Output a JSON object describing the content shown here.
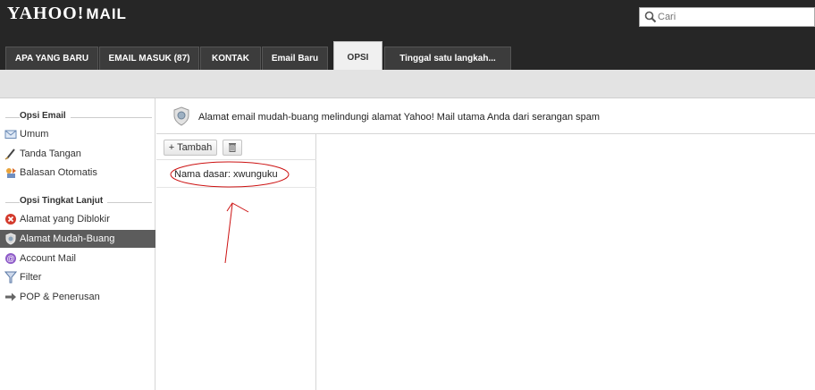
{
  "app": {
    "logo_text": "YAHOO!",
    "logo_suffix": "MAIL"
  },
  "search": {
    "placeholder": "Cari",
    "value": ""
  },
  "tabs": [
    {
      "label": "APA YANG BARU"
    },
    {
      "label": "EMAIL MASUK (87)"
    },
    {
      "label": "KONTAK"
    },
    {
      "label": "Email Baru"
    },
    {
      "label": "OPSI"
    },
    {
      "label": "Tinggal satu langkah..."
    }
  ],
  "sidebar": {
    "section_email": "Opsi Email",
    "section_advanced": "Opsi Tingkat Lanjut",
    "items": [
      {
        "label": "Umum",
        "icon": "envelope-icon"
      },
      {
        "label": "Tanda Tangan",
        "icon": "pen-icon"
      },
      {
        "label": "Balasan Otomatis",
        "icon": "auto-reply-icon"
      },
      {
        "label": "Alamat yang Diblokir",
        "icon": "blocked-icon"
      },
      {
        "label": "Alamat Mudah-Buang",
        "icon": "shield-icon"
      },
      {
        "label": "Account Mail",
        "icon": "account-mail-icon"
      },
      {
        "label": "Filter",
        "icon": "filter-funnel-icon"
      },
      {
        "label": "POP & Penerusan",
        "icon": "forward-arrow-icon"
      }
    ]
  },
  "main": {
    "description": "Alamat email mudah-buang melindungi alamat Yahoo! Mail utama Anda dari serangan spam",
    "add_button": "+ Tambah",
    "list_item_prefix": "Nama dasar: ",
    "list_item_value": "xwunguku"
  },
  "colors": {
    "topbar": "#262626",
    "active_sidebar": "#5c5c5c",
    "annotation": "#cc1111"
  }
}
